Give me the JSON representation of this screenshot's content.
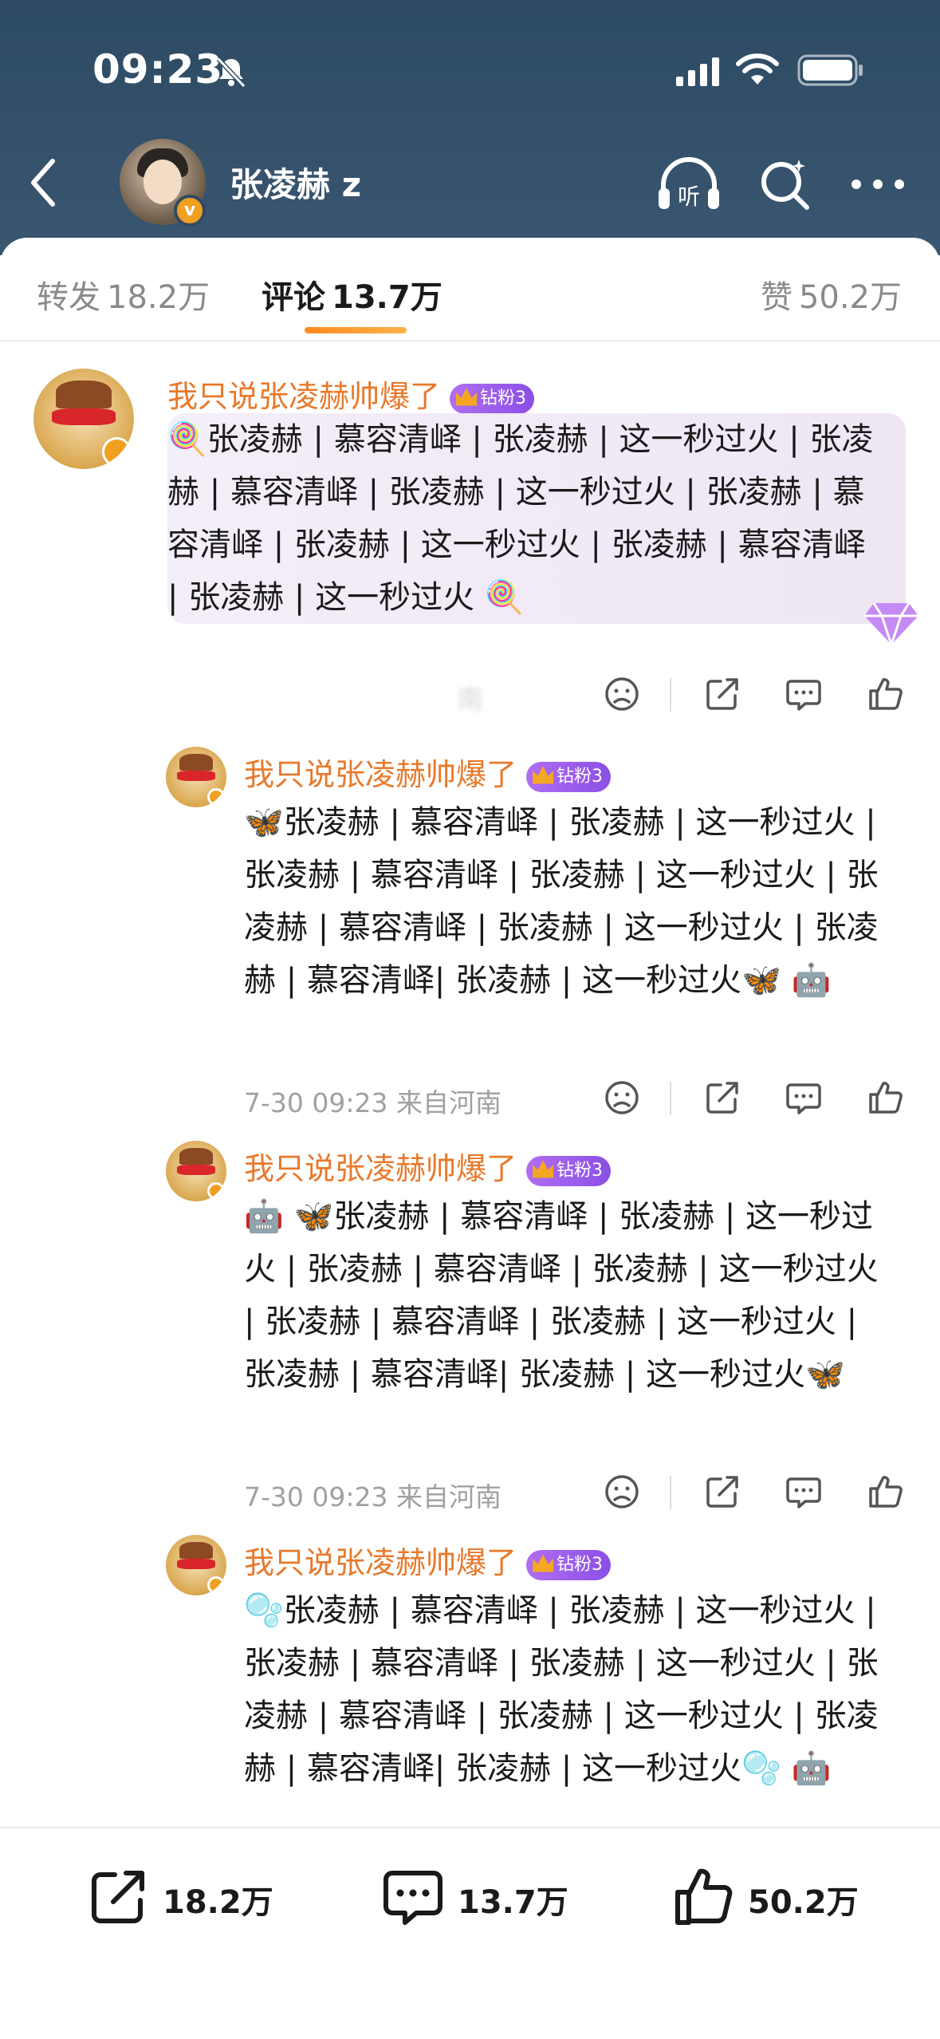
{
  "status_bar": {
    "time": "09:23"
  },
  "header": {
    "username": "张凌赫 z"
  },
  "tabs": {
    "repost": {
      "label": "转发",
      "count": "18.2万"
    },
    "comment": {
      "label": "评论",
      "count": "13.7万"
    },
    "like": {
      "label": "赞",
      "count": "50.2万"
    }
  },
  "comments": [
    {
      "name": "我只说张凌赫帅爆了",
      "badge": "钻粉3",
      "text": "🍭张凌赫 | 慕容清峄 | 张凌赫 | 这一秒过火 | 张凌赫 | 慕容清峄 | 张凌赫 | 这一秒过火 | 张凌赫 | 慕容清峄 | 张凌赫 | 这一秒过火 | 张凌赫 | 慕容清峄 | 张凌赫 | 这一秒过火 🍭",
      "meta": "　　　　　　　　　　　南"
    },
    {
      "name": "我只说张凌赫帅爆了",
      "badge": "钻粉3",
      "text": "🦋张凌赫 | 慕容清峄 | 张凌赫 | 这一秒过火 | 张凌赫 | 慕容清峄 | 张凌赫 | 这一秒过火 | 张凌赫 | 慕容清峄 | 张凌赫 | 这一秒过火 | 张凌赫 | 慕容清峄| 张凌赫 | 这一秒过火🦋 🤖",
      "meta": "7-30 09:23  来自河南"
    },
    {
      "name": "我只说张凌赫帅爆了",
      "badge": "钻粉3",
      "text": "🤖 🦋张凌赫 | 慕容清峄 | 张凌赫 | 这一秒过火 | 张凌赫 | 慕容清峄 | 张凌赫 | 这一秒过火 | 张凌赫 | 慕容清峄 | 张凌赫 | 这一秒过火 | 张凌赫 | 慕容清峄| 张凌赫 | 这一秒过火🦋",
      "meta": "7-30 09:23  来自河南"
    },
    {
      "name": "我只说张凌赫帅爆了",
      "badge": "钻粉3",
      "text": "🫧张凌赫 | 慕容清峄 | 张凌赫 | 这一秒过火 | 张凌赫 | 慕容清峄 | 张凌赫 | 这一秒过火 | 张凌赫 | 慕容清峄 | 张凌赫 | 这一秒过火 | 张凌赫 | 慕容清峄| 张凌赫 | 这一秒过火🫧 🤖",
      "meta": ""
    }
  ],
  "bottom_bar": {
    "repost_count": "18.2万",
    "comment_count": "13.7万",
    "like_count": "50.2万"
  },
  "colors": {
    "header_bg": "#2f4b64",
    "accent_orange": "#e8792b",
    "badge_purple": "#9a5cf0"
  }
}
